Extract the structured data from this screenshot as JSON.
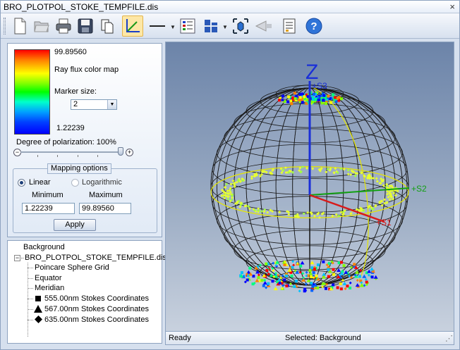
{
  "window": {
    "title": "BRO_PLOTPOL_STOKE_TEMPFILE.dis",
    "close_glyph": "×"
  },
  "toolbar": {
    "buttons": [
      {
        "name": "new-document-icon"
      },
      {
        "name": "open-folder-icon"
      },
      {
        "name": "print-icon"
      },
      {
        "name": "save-icon"
      },
      {
        "name": "copy-icon"
      },
      {
        "name": "axes-icon",
        "active": true
      },
      {
        "name": "line-style-icon"
      },
      {
        "name": "legend-icon"
      },
      {
        "name": "layout-icon"
      },
      {
        "name": "cube-view-icon"
      },
      {
        "name": "lens-icon"
      },
      {
        "name": "report-icon"
      },
      {
        "name": "help-icon"
      }
    ]
  },
  "colormap": {
    "max": "99.89560",
    "min": "1.22239",
    "title": "Ray flux color map",
    "marker_size_label": "Marker size:",
    "marker_size_value": "2",
    "degree_label": "Degree of polarization: 100%",
    "slider_value_percent": 100
  },
  "mapping": {
    "legend": "Mapping options",
    "linear_label": "Linear",
    "log_label": "Logarithmic",
    "selected": "Linear",
    "minimum_label": "Minimum",
    "maximum_label": "Maximum",
    "minimum_value": "1.22239",
    "maximum_value": "99.89560",
    "apply_label": "Apply"
  },
  "tree": {
    "root": "Background",
    "file": "BRO_PLOTPOL_STOKE_TEMPFILE.dis",
    "items": [
      {
        "label": "Poincare Sphere Grid",
        "marker": ""
      },
      {
        "label": "Equator",
        "marker": ""
      },
      {
        "label": "Meridian",
        "marker": ""
      },
      {
        "label": "555.00nm Stokes Coordinates",
        "marker": "square"
      },
      {
        "label": "567.00nm Stokes Coordinates",
        "marker": "triangle"
      },
      {
        "label": "635.00nm Stokes Coordinates",
        "marker": "diamond"
      }
    ]
  },
  "plot": {
    "axis_z_label": "Z",
    "s3_label": "+S3",
    "s2_label": "+S2",
    "s1_label": "+S1",
    "colors": {
      "z_axis": "#1a2fd8",
      "s2_axis": "#12a012",
      "s1_axis": "#d81a1a",
      "equator": "#e6e600",
      "grid": "#1a1a1a"
    }
  },
  "status": {
    "left": "Ready",
    "right": "Selected: Background"
  }
}
